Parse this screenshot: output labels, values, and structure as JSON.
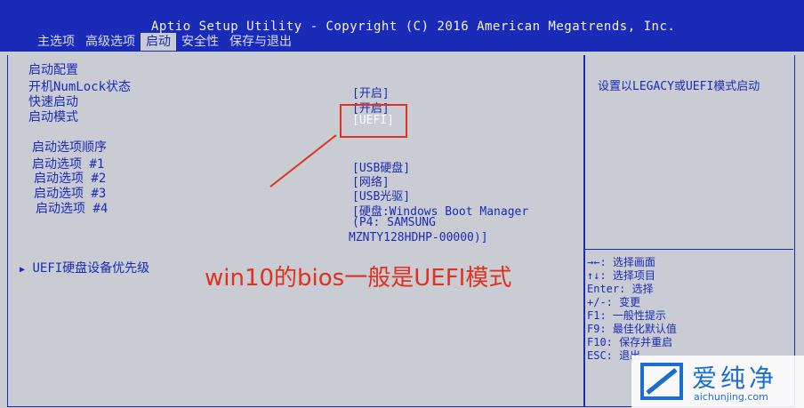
{
  "header": {
    "title": "Aptio Setup Utility - Copyright (C) 2016 American Megatrends, Inc.",
    "tabs": [
      "主选项",
      "高级选项",
      "启动",
      "安全性",
      "保存与退出"
    ],
    "active_tab": "启动"
  },
  "boot_config": {
    "section_label": "启动配置",
    "items": [
      {
        "label": "开机NumLock状态",
        "value": "[开启]"
      },
      {
        "label": "快速启动",
        "value": "[开启]"
      },
      {
        "label": "启动模式",
        "value": "[UEFI]"
      }
    ]
  },
  "boot_order": {
    "section_label": "启动选项顺序",
    "items": [
      {
        "label": "启动选项 #1",
        "value": "[USB硬盘]"
      },
      {
        "label": "启动选项 #2",
        "value": "[网络]"
      },
      {
        "label": "启动选项 #3",
        "value": "[USB光驱]"
      },
      {
        "label": "启动选项 #4",
        "value": "[硬盘:Windows Boot Manager",
        "value_line2": "(P4: SAMSUNG",
        "value_line3": "MZNTY128HDHP-00000)]"
      }
    ]
  },
  "submenu": {
    "label": "UEFI硬盘设备优先级",
    "marker": "▶"
  },
  "help_text": "设置以LEGACY或UEFI模式启动",
  "key_help": [
    "→←: 选择画面",
    "↑↓: 选择项目",
    "Enter: 选择",
    "+/-: 变更",
    "F1: 一般性提示",
    "F9: 最佳化默认值",
    "F10: 保存并重启",
    "ESC: 退出"
  ],
  "annotation": "win10的bios一般是UEFI模式",
  "watermark": {
    "name": "爱纯净",
    "url": "aichunjing.com"
  },
  "colors": {
    "bios_blue": "#1a2bb8",
    "bios_bg": "#c9ccd3",
    "annotation_red": "#e0301e",
    "watermark_blue": "#1c6dd0"
  }
}
